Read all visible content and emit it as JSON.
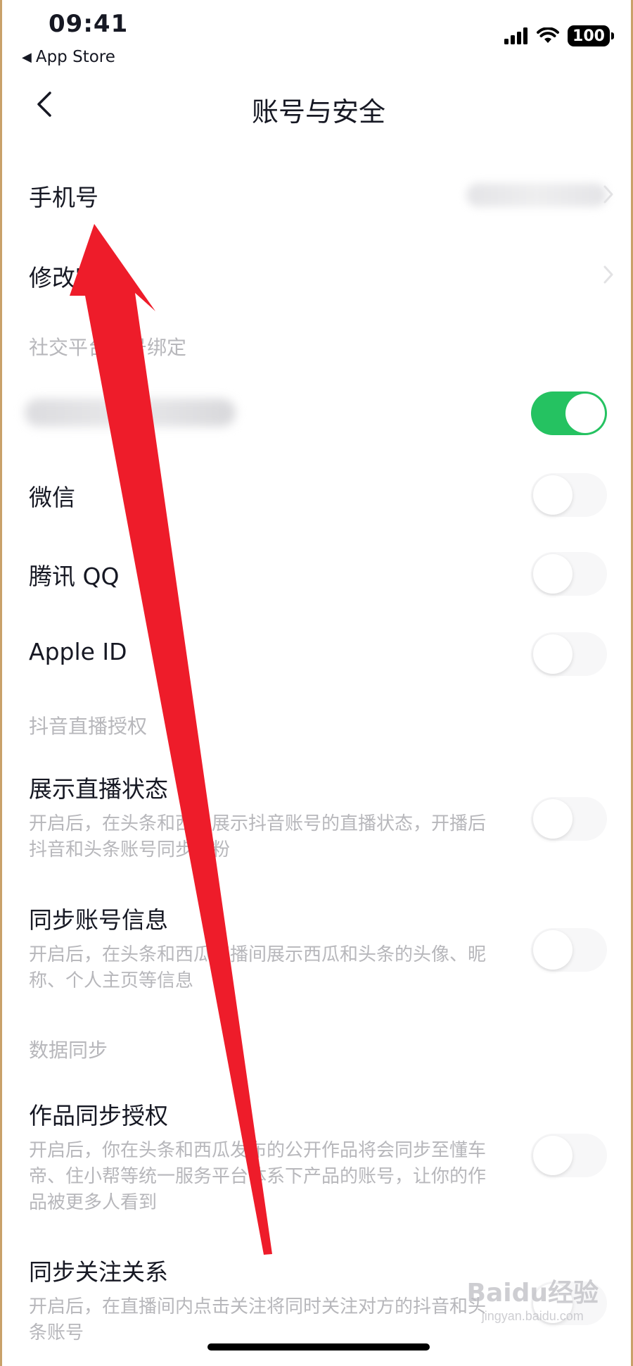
{
  "status_bar": {
    "time": "09:41",
    "back_app_label": "App Store",
    "battery_level": "100",
    "icons": [
      "cellular-signal-icon",
      "wifi-icon",
      "battery-icon"
    ]
  },
  "nav": {
    "title": "账号与安全",
    "back_icon": "chevron-left-icon"
  },
  "rows": {
    "phone": {
      "label": "手机号"
    },
    "change_password": {
      "label": "修改密码"
    }
  },
  "sections": {
    "social_binding": "社交平台账号绑定",
    "live_auth": "抖音直播授权",
    "data_sync": "数据同步"
  },
  "social": {
    "blurred_account": {
      "toggle_on": true
    },
    "wechat": {
      "label": "微信",
      "toggle_on": false
    },
    "qq": {
      "label": "腾讯 QQ",
      "toggle_on": false
    },
    "apple": {
      "label": "Apple ID",
      "toggle_on": false
    }
  },
  "live": {
    "show_status": {
      "label": "展示直播状态",
      "desc": "开启后，在头条和西瓜展示抖音账号的直播状态，开播后抖音和头条账号同步涨粉",
      "toggle_on": false
    },
    "sync_info": {
      "label": "同步账号信息",
      "desc": "开启后，在头条和西瓜直播间展示西瓜和头条的头像、昵称、个人主页等信息",
      "toggle_on": false
    }
  },
  "sync": {
    "works_auth": {
      "label": "作品同步授权",
      "desc": "开启后，你在头条和西瓜发布的公开作品将会同步至懂车帝、住小帮等统一服务平台体系下产品的账号，让你的作品被更多人看到",
      "toggle_on": false
    },
    "follow_sync": {
      "label": "同步关注关系",
      "desc": "开启后，在直播间内点击关注将同时关注对方的抖音和头条账号",
      "toggle_on": false
    }
  },
  "watermark": {
    "main": "Baidu经验",
    "sub": "jingyan.baidu.com"
  },
  "colors": {
    "toggle_on": "#25c261",
    "toggle_off": "#f7f7f8",
    "annotation_arrow": "#ee1c2a",
    "secondary_text": "#b7b7bb",
    "primary_text": "#161823"
  }
}
